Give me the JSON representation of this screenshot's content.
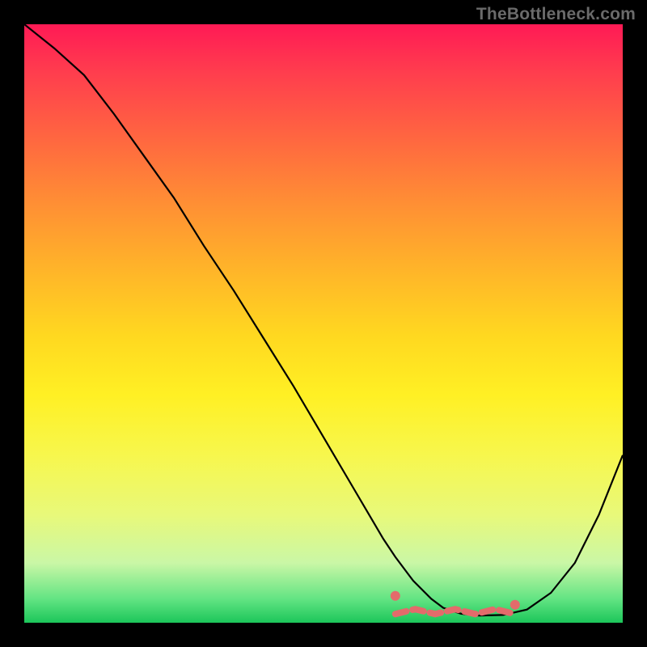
{
  "watermark": "TheBottleneck.com",
  "chart_data": {
    "type": "line",
    "title": "",
    "xlabel": "",
    "ylabel": "",
    "xlim": [
      0,
      100
    ],
    "ylim": [
      0,
      100
    ],
    "series": [
      {
        "name": "curve",
        "x": [
          0,
          5,
          10,
          15,
          20,
          25,
          30,
          35,
          40,
          45,
          50,
          55,
          60,
          62,
          65,
          68,
          70,
          73,
          76,
          80,
          84,
          88,
          92,
          96,
          100
        ],
        "values": [
          100,
          96,
          91.5,
          85,
          78,
          71,
          63,
          55.5,
          47.5,
          39.5,
          31,
          22.5,
          14,
          11,
          7,
          4,
          2.5,
          1.5,
          1.2,
          1.3,
          2.2,
          5,
          10,
          18,
          28
        ]
      }
    ],
    "highlight_range": {
      "x_from": 62,
      "x_to": 82,
      "y_approx": 2
    },
    "highlight_endpoints": [
      {
        "x": 62,
        "y": 4.5
      },
      {
        "x": 82,
        "y": 3.0
      }
    ]
  }
}
